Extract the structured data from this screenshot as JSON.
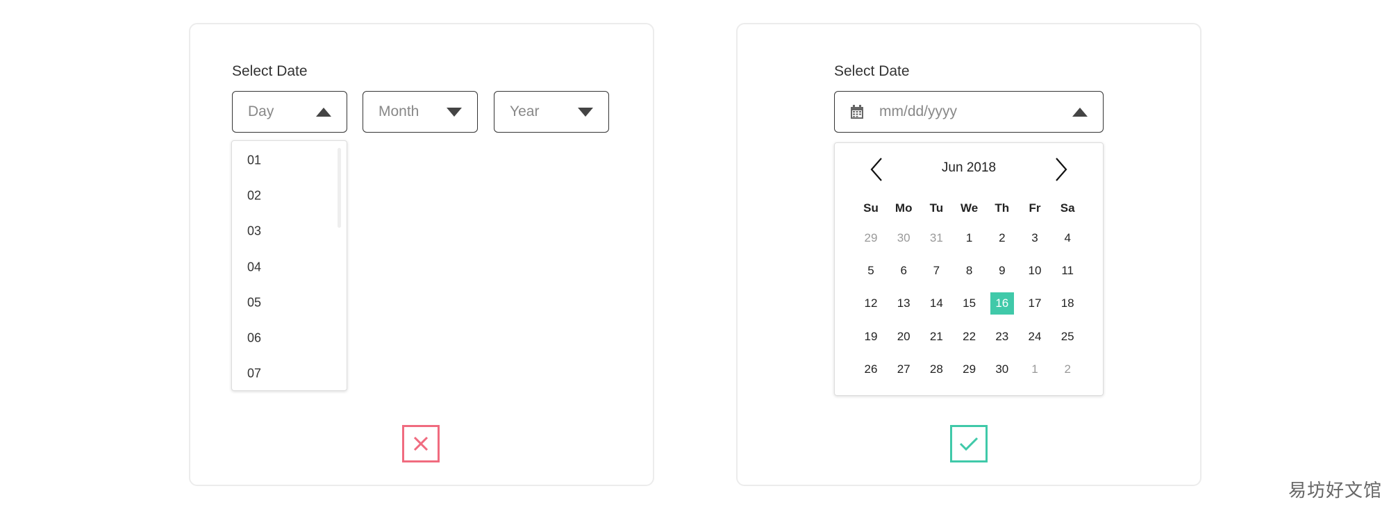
{
  "colors": {
    "error": "#f06b7f",
    "success": "#40c9a9",
    "selected": "#40c9a9"
  },
  "left": {
    "label": "Select Date",
    "day": {
      "placeholder": "Day",
      "icon": "caret-up-icon"
    },
    "month": {
      "placeholder": "Month",
      "icon": "caret-down-icon"
    },
    "year": {
      "placeholder": "Year",
      "icon": "caret-down-icon"
    },
    "day_options": [
      "01",
      "02",
      "03",
      "04",
      "05",
      "06",
      "07"
    ],
    "status_icon": "close-icon"
  },
  "right": {
    "label": "Select Date",
    "input": {
      "placeholder": "mm/dd/yyyy",
      "icon": "calendar-icon",
      "toggle_icon": "caret-up-icon"
    },
    "calendar": {
      "month_label": "Jun 2018",
      "weekdays": [
        "Su",
        "Mo",
        "Tu",
        "We",
        "Th",
        "Fr",
        "Sa"
      ],
      "weeks": [
        [
          {
            "d": "29",
            "m": true
          },
          {
            "d": "30",
            "m": true
          },
          {
            "d": "31",
            "m": true
          },
          {
            "d": "1"
          },
          {
            "d": "2"
          },
          {
            "d": "3"
          },
          {
            "d": "4"
          }
        ],
        [
          {
            "d": "5"
          },
          {
            "d": "6"
          },
          {
            "d": "7"
          },
          {
            "d": "8"
          },
          {
            "d": "9"
          },
          {
            "d": "10"
          },
          {
            "d": "11"
          }
        ],
        [
          {
            "d": "12"
          },
          {
            "d": "13"
          },
          {
            "d": "14"
          },
          {
            "d": "15"
          },
          {
            "d": "16",
            "s": true
          },
          {
            "d": "17"
          },
          {
            "d": "18"
          }
        ],
        [
          {
            "d": "19"
          },
          {
            "d": "20"
          },
          {
            "d": "21"
          },
          {
            "d": "22"
          },
          {
            "d": "23"
          },
          {
            "d": "24"
          },
          {
            "d": "25"
          }
        ],
        [
          {
            "d": "26"
          },
          {
            "d": "27"
          },
          {
            "d": "28"
          },
          {
            "d": "29"
          },
          {
            "d": "30"
          },
          {
            "d": "1",
            "m": true
          },
          {
            "d": "2",
            "m": true
          }
        ]
      ]
    },
    "status_icon": "check-icon"
  },
  "watermark": "易坊好文馆"
}
